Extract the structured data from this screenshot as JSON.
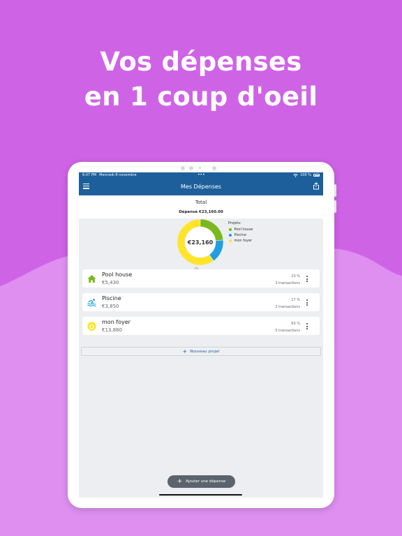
{
  "headline": {
    "line1": "Vos dépenses",
    "line2": "en 1 coup d'oeil"
  },
  "colors": {
    "background": "#cf63e6",
    "wave": "#de8ff0",
    "navbar": "#1d5f9b",
    "green": "#7ab91e",
    "blue": "#1f9fe0",
    "yellow": "#ffe42a"
  },
  "status_bar": {
    "time": "6:07 PM",
    "date": "Mercredi 8 novembre",
    "dots": "•••",
    "battery": "100 %"
  },
  "navbar": {
    "title": "Mes Dépenses",
    "menu_icon": "hamburger-menu-icon",
    "share_icon": "share-icon"
  },
  "total": {
    "title": "Total",
    "spent": "Dépensé €23,160.00",
    "center_value": "€23,160"
  },
  "legend": {
    "title": "Projets:",
    "items": [
      {
        "label": "Pool house",
        "color": "#7ab91e"
      },
      {
        "label": "Piscine",
        "color": "#1f9fe0"
      },
      {
        "label": "mon foyer",
        "color": "#ffe42a"
      }
    ]
  },
  "chart_data": {
    "type": "pie",
    "categories": [
      "Pool house",
      "Piscine",
      "mon foyer"
    ],
    "values": [
      5430,
      3850,
      13880
    ],
    "percent": [
      23,
      17,
      60
    ],
    "center_label": "€23,160"
  },
  "projects": [
    {
      "name": "Pool house",
      "amount": "€5,430",
      "percent": "23 %",
      "transactions": "3 transactions",
      "icon": "house-icon"
    },
    {
      "name": "Piscine",
      "amount": "€3,850",
      "percent": "17 %",
      "transactions": "2 transactions",
      "icon": "swimming-pool-icon"
    },
    {
      "name": "mon foyer",
      "amount": "€13,880",
      "percent": "60 %",
      "transactions": "5 transactions",
      "icon": "home-circle-icon"
    }
  ],
  "new_project": {
    "plus": "+",
    "label": "Nouveau projet"
  },
  "add_expense": {
    "plus": "+",
    "label": "Ajouter une dépense"
  }
}
